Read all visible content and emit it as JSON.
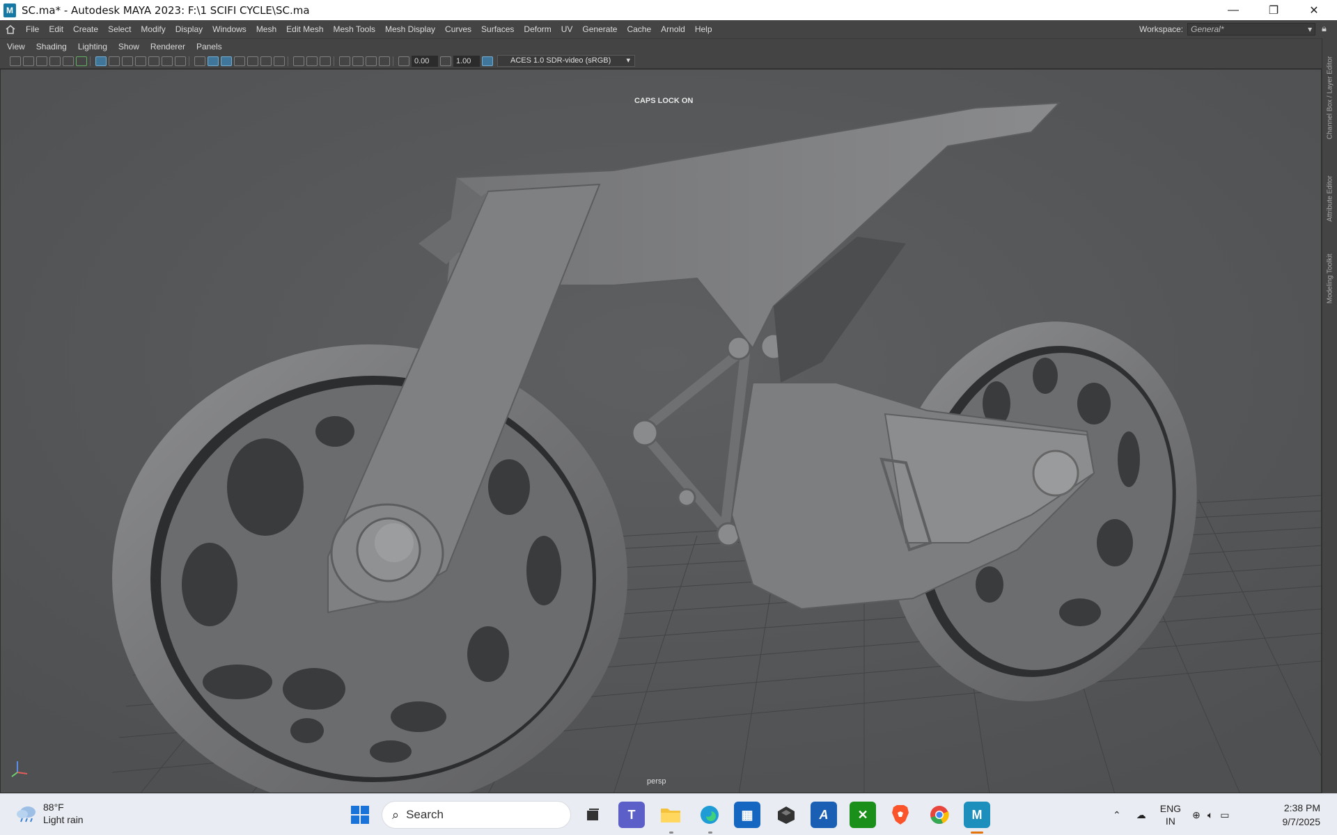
{
  "window": {
    "title": "SC.ma* - Autodesk MAYA 2023: F:\\1 SCIFI CYCLE\\SC.ma",
    "app_icon_label": "M",
    "minimize_glyph": "—",
    "restore_glyph": "❐",
    "close_glyph": "✕"
  },
  "menubar": {
    "items": [
      "File",
      "Edit",
      "Create",
      "Select",
      "Modify",
      "Display",
      "Windows",
      "Mesh",
      "Edit Mesh",
      "Mesh Tools",
      "Mesh Display",
      "Curves",
      "Surfaces",
      "Deform",
      "UV",
      "Generate",
      "Cache",
      "Arnold",
      "Help"
    ],
    "workspace_label": "Workspace:",
    "workspace_value": "General*"
  },
  "panel_menu": {
    "items": [
      "View",
      "Shading",
      "Lighting",
      "Show",
      "Renderer",
      "Panels"
    ]
  },
  "toolbar": {
    "exposure": "0.00",
    "gamma": "1.00",
    "color_space": "ACES 1.0 SDR-video (sRGB)"
  },
  "viewport": {
    "caps_lock_text": "CAPS LOCK ON",
    "camera_label": "persp"
  },
  "right_dock": {
    "tabs": [
      "Channel Box / Layer Editor",
      "Attribute Editor",
      "Modeling Toolkit"
    ]
  },
  "taskbar": {
    "weather_temp": "88°F",
    "weather_desc": "Light rain",
    "search_placeholder": "Search",
    "lang_line1": "ENG",
    "lang_line2": "IN",
    "time": "2:38 PM",
    "date": "9/7/2025",
    "apps": [
      "start",
      "search",
      "task-view",
      "teams",
      "file-explorer",
      "edge",
      "store",
      "unity",
      "autodesk",
      "xbox",
      "brave",
      "chrome",
      "maya"
    ]
  }
}
